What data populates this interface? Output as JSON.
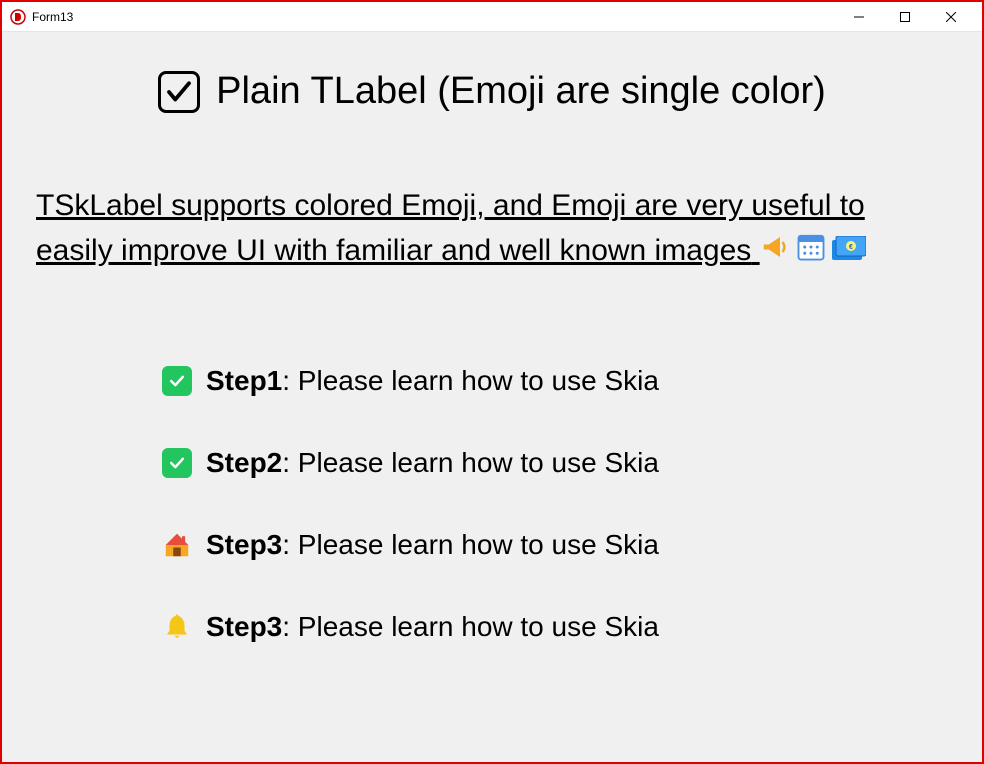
{
  "window": {
    "title": "Form13"
  },
  "heading": {
    "text": "Plain TLabel (Emoji are single color)"
  },
  "subtitle": {
    "text": "TSkLabel supports colored Emoji, and Emoji are very useful to easily improve UI with familiar and well known images"
  },
  "steps": [
    {
      "icon": "check-green",
      "bold": "Step1",
      "text": ": Please learn how to use Skia"
    },
    {
      "icon": "check-green",
      "bold": "Step2",
      "text": ": Please learn how to use Skia"
    },
    {
      "icon": "house",
      "bold": "Step3",
      "text": ": Please learn how to use Skia"
    },
    {
      "icon": "bell",
      "bold": "Step3",
      "text": ": Please learn how to use Skia"
    }
  ]
}
